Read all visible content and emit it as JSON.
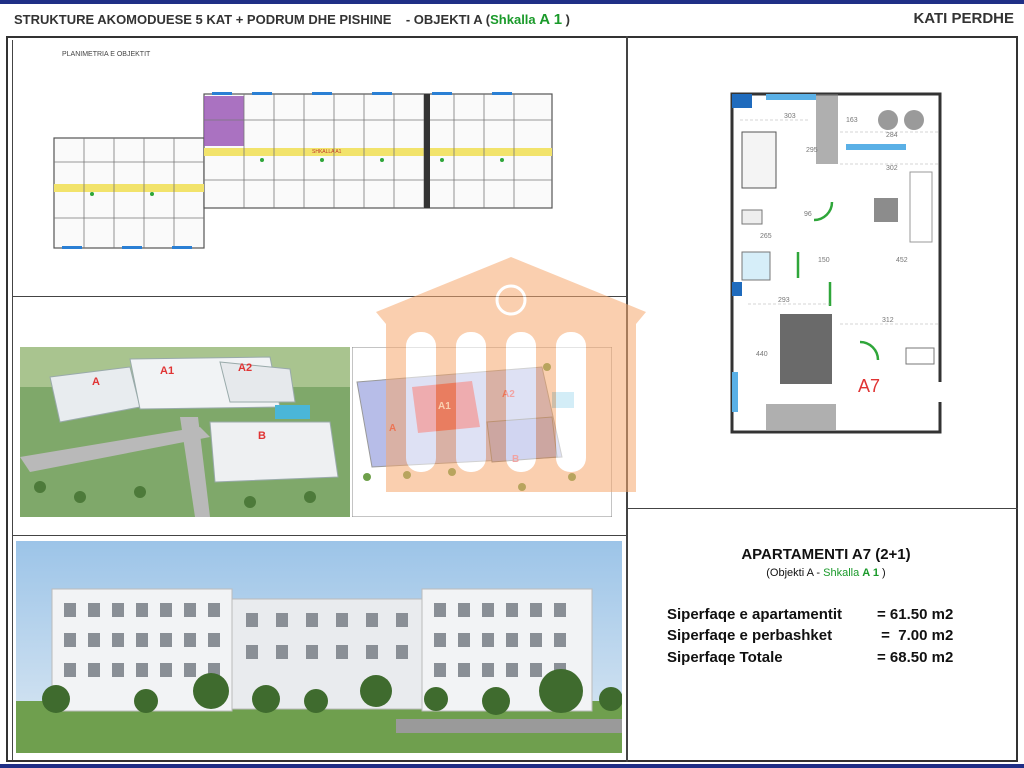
{
  "header": {
    "title_main": "STRUKTURE AKOMODUESE 5 KAT + PODRUM DHE PISHINE",
    "title_object": "-  OBJEKTI A (",
    "title_shkalla": "Shkalla ",
    "title_shkalla_code": "A 1",
    "title_close": " )",
    "floor": "KATI PERDHE"
  },
  "site_plan": {
    "label": "PLANIMETRIA E OBJEKTIT",
    "blocks": [
      "A",
      "A1",
      "A2",
      "B"
    ],
    "corridor_label": "SHKALLA A1"
  },
  "unit_plan": {
    "unit_label": "A7",
    "dimensions": [
      "303",
      "163",
      "284",
      "295",
      "302",
      "96",
      "150",
      "452",
      "293",
      "312",
      "440",
      "265"
    ]
  },
  "apartment": {
    "title": "APARTAMENTI A7 (2+1)",
    "sub_prefix": "(Objekti A - ",
    "sub_shkalla": "Shkalla ",
    "sub_code": "A 1",
    "sub_suffix": " )",
    "rows": [
      {
        "label": "Siperfaqe e apartamentit",
        "value": "= 61.50 m2"
      },
      {
        "label": "Siperfaqe e perbashket",
        "value": " =  7.00 m2"
      },
      {
        "label": "Siperfaqe Totale",
        "value": "= 68.50 m2"
      }
    ]
  },
  "colors": {
    "accent_blue": "#1f2f86",
    "green": "#1a9a2a",
    "highlight_purple": "#9b59b6",
    "corridor_yellow": "#f2e36b",
    "watermark": "#f6a96f",
    "block_red": "#e03434"
  }
}
